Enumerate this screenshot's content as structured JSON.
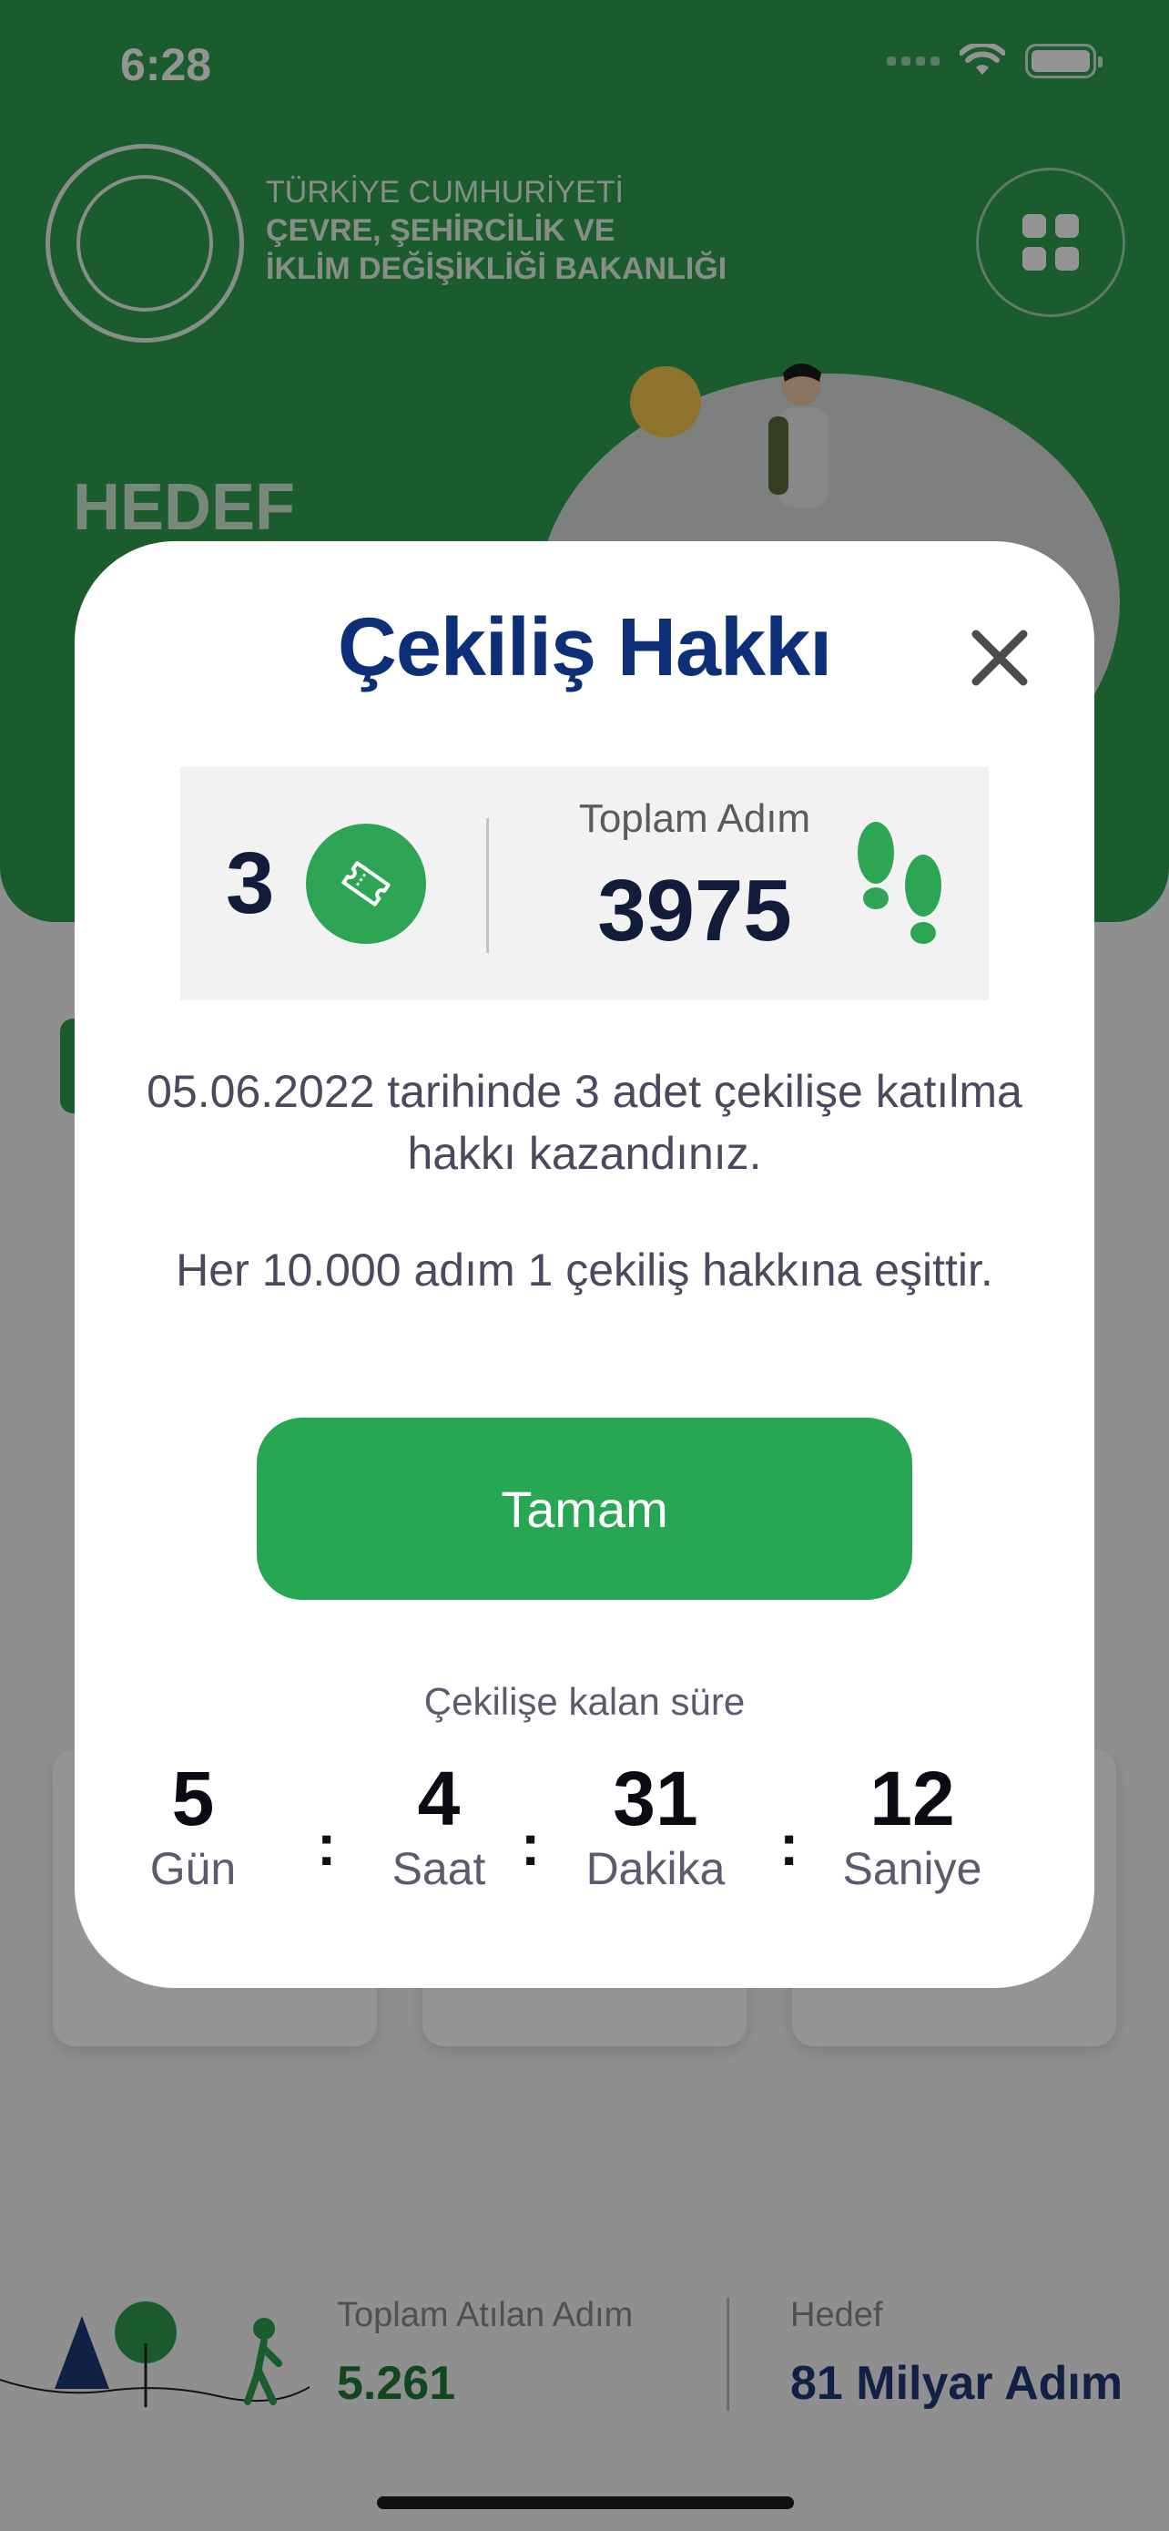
{
  "status_bar": {
    "time": "6:28"
  },
  "header": {
    "ministry_line1": "TÜRKİYE CUMHURİYETİ",
    "ministry_line2": "ÇEVRE, ŞEHİRCİLİK VE",
    "ministry_line3": "İKLİM DEĞİŞİKLİĞİ BAKANLIĞI",
    "section_title": "HEDEF",
    "menu_icon": "grid-icon"
  },
  "footer": {
    "total_label": "Toplam Atılan Adım",
    "total_value": "5.261",
    "goal_label": "Hedef",
    "goal_value": "81 Milyar Adım"
  },
  "modal": {
    "title": "Çekiliş Hakkı",
    "close_icon": "close-icon",
    "ticket_count": "3",
    "ticket_icon": "ticket-icon",
    "steps_label": "Toplam Adım",
    "steps_value": "3975",
    "steps_icon": "footsteps-icon",
    "message_1": "05.06.2022 tarihinde 3 adet çekilişe katılma hakkı kazandınız.",
    "message_2": "Her 10.000 adım 1 çekiliş hakkına eşittir.",
    "ok_button": "Tamam",
    "countdown_label": "Çekilişe kalan süre",
    "countdown": [
      {
        "value": "5",
        "label": "Gün"
      },
      {
        "value": "4",
        "label": "Saat"
      },
      {
        "value": "31",
        "label": "Dakika"
      },
      {
        "value": "12",
        "label": "Saniye"
      }
    ],
    "separator": ":"
  },
  "colors": {
    "brand_green": "#2e9f4e",
    "button_green": "#27a653",
    "title_blue": "#0d2f78"
  }
}
